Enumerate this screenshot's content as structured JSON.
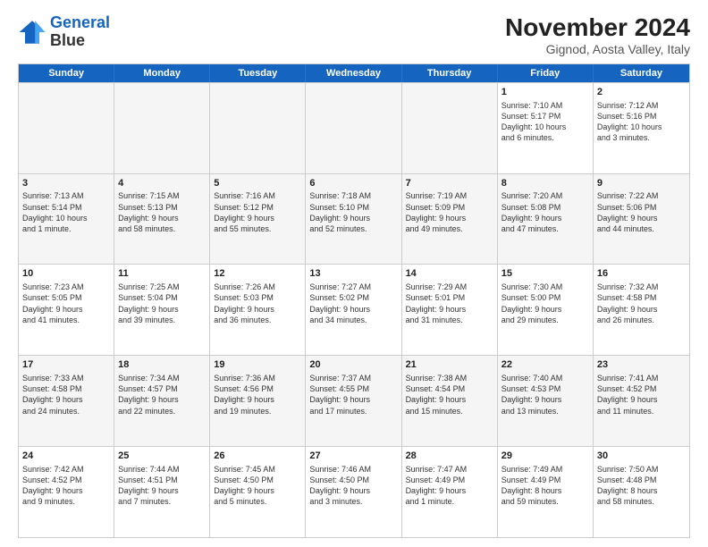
{
  "logo": {
    "line1": "General",
    "line2": "Blue"
  },
  "title": "November 2024",
  "subtitle": "Gignod, Aosta Valley, Italy",
  "weekdays": [
    "Sunday",
    "Monday",
    "Tuesday",
    "Wednesday",
    "Thursday",
    "Friday",
    "Saturday"
  ],
  "rows": [
    [
      {
        "day": "",
        "info": "",
        "empty": true
      },
      {
        "day": "",
        "info": "",
        "empty": true
      },
      {
        "day": "",
        "info": "",
        "empty": true
      },
      {
        "day": "",
        "info": "",
        "empty": true
      },
      {
        "day": "",
        "info": "",
        "empty": true
      },
      {
        "day": "1",
        "info": "Sunrise: 7:10 AM\nSunset: 5:17 PM\nDaylight: 10 hours\nand 6 minutes."
      },
      {
        "day": "2",
        "info": "Sunrise: 7:12 AM\nSunset: 5:16 PM\nDaylight: 10 hours\nand 3 minutes."
      }
    ],
    [
      {
        "day": "3",
        "info": "Sunrise: 7:13 AM\nSunset: 5:14 PM\nDaylight: 10 hours\nand 1 minute."
      },
      {
        "day": "4",
        "info": "Sunrise: 7:15 AM\nSunset: 5:13 PM\nDaylight: 9 hours\nand 58 minutes."
      },
      {
        "day": "5",
        "info": "Sunrise: 7:16 AM\nSunset: 5:12 PM\nDaylight: 9 hours\nand 55 minutes."
      },
      {
        "day": "6",
        "info": "Sunrise: 7:18 AM\nSunset: 5:10 PM\nDaylight: 9 hours\nand 52 minutes."
      },
      {
        "day": "7",
        "info": "Sunrise: 7:19 AM\nSunset: 5:09 PM\nDaylight: 9 hours\nand 49 minutes."
      },
      {
        "day": "8",
        "info": "Sunrise: 7:20 AM\nSunset: 5:08 PM\nDaylight: 9 hours\nand 47 minutes."
      },
      {
        "day": "9",
        "info": "Sunrise: 7:22 AM\nSunset: 5:06 PM\nDaylight: 9 hours\nand 44 minutes."
      }
    ],
    [
      {
        "day": "10",
        "info": "Sunrise: 7:23 AM\nSunset: 5:05 PM\nDaylight: 9 hours\nand 41 minutes."
      },
      {
        "day": "11",
        "info": "Sunrise: 7:25 AM\nSunset: 5:04 PM\nDaylight: 9 hours\nand 39 minutes."
      },
      {
        "day": "12",
        "info": "Sunrise: 7:26 AM\nSunset: 5:03 PM\nDaylight: 9 hours\nand 36 minutes."
      },
      {
        "day": "13",
        "info": "Sunrise: 7:27 AM\nSunset: 5:02 PM\nDaylight: 9 hours\nand 34 minutes."
      },
      {
        "day": "14",
        "info": "Sunrise: 7:29 AM\nSunset: 5:01 PM\nDaylight: 9 hours\nand 31 minutes."
      },
      {
        "day": "15",
        "info": "Sunrise: 7:30 AM\nSunset: 5:00 PM\nDaylight: 9 hours\nand 29 minutes."
      },
      {
        "day": "16",
        "info": "Sunrise: 7:32 AM\nSunset: 4:58 PM\nDaylight: 9 hours\nand 26 minutes."
      }
    ],
    [
      {
        "day": "17",
        "info": "Sunrise: 7:33 AM\nSunset: 4:58 PM\nDaylight: 9 hours\nand 24 minutes."
      },
      {
        "day": "18",
        "info": "Sunrise: 7:34 AM\nSunset: 4:57 PM\nDaylight: 9 hours\nand 22 minutes."
      },
      {
        "day": "19",
        "info": "Sunrise: 7:36 AM\nSunset: 4:56 PM\nDaylight: 9 hours\nand 19 minutes."
      },
      {
        "day": "20",
        "info": "Sunrise: 7:37 AM\nSunset: 4:55 PM\nDaylight: 9 hours\nand 17 minutes."
      },
      {
        "day": "21",
        "info": "Sunrise: 7:38 AM\nSunset: 4:54 PM\nDaylight: 9 hours\nand 15 minutes."
      },
      {
        "day": "22",
        "info": "Sunrise: 7:40 AM\nSunset: 4:53 PM\nDaylight: 9 hours\nand 13 minutes."
      },
      {
        "day": "23",
        "info": "Sunrise: 7:41 AM\nSunset: 4:52 PM\nDaylight: 9 hours\nand 11 minutes."
      }
    ],
    [
      {
        "day": "24",
        "info": "Sunrise: 7:42 AM\nSunset: 4:52 PM\nDaylight: 9 hours\nand 9 minutes."
      },
      {
        "day": "25",
        "info": "Sunrise: 7:44 AM\nSunset: 4:51 PM\nDaylight: 9 hours\nand 7 minutes."
      },
      {
        "day": "26",
        "info": "Sunrise: 7:45 AM\nSunset: 4:50 PM\nDaylight: 9 hours\nand 5 minutes."
      },
      {
        "day": "27",
        "info": "Sunrise: 7:46 AM\nSunset: 4:50 PM\nDaylight: 9 hours\nand 3 minutes."
      },
      {
        "day": "28",
        "info": "Sunrise: 7:47 AM\nSunset: 4:49 PM\nDaylight: 9 hours\nand 1 minute."
      },
      {
        "day": "29",
        "info": "Sunrise: 7:49 AM\nSunset: 4:49 PM\nDaylight: 8 hours\nand 59 minutes."
      },
      {
        "day": "30",
        "info": "Sunrise: 7:50 AM\nSunset: 4:48 PM\nDaylight: 8 hours\nand 58 minutes."
      }
    ]
  ]
}
